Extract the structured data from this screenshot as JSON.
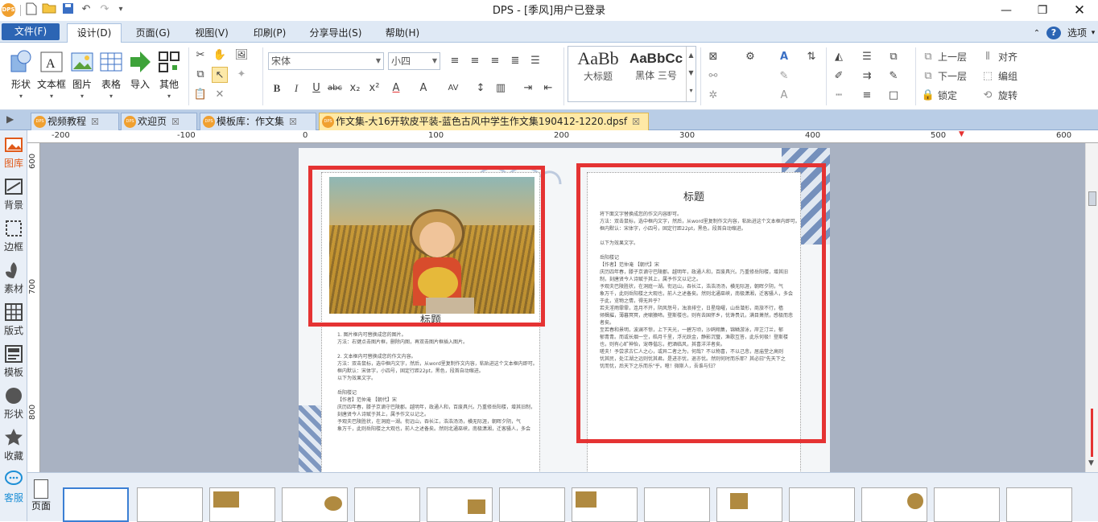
{
  "app": {
    "title": "DPS - [季风]用户已登录",
    "logo": "DPS"
  },
  "menu": {
    "file": "文件(F)",
    "tabs": [
      "设计(D)",
      "页面(G)",
      "视图(V)",
      "印刷(P)",
      "分享导出(S)",
      "帮助(H)"
    ],
    "options": "选项"
  },
  "ribbon": {
    "buttons": [
      "形状",
      "文本框",
      "图片",
      "表格",
      "导入",
      "其他"
    ],
    "font_name": "宋体",
    "font_size": "小四",
    "styles": [
      {
        "sample": "AaBb",
        "label": "大标题"
      },
      {
        "sample": "AaBbCc",
        "label": "黑体 三号"
      }
    ],
    "arrange": [
      "上一层",
      "下一层",
      "锁定",
      "对齐",
      "编组",
      "旋转"
    ]
  },
  "doc_tabs": [
    {
      "label": "视频教程"
    },
    {
      "label": "欢迎页"
    },
    {
      "label": "模板库：作文集"
    },
    {
      "label": "作文集-大16开软皮平装-蓝色古风中学生作文集190412-1220.dpsf",
      "active": true
    }
  ],
  "left_tools": [
    "图库",
    "背景",
    "边框",
    "素材",
    "版式",
    "模板",
    "形状",
    "收藏",
    "客服"
  ],
  "bottom": {
    "page_label": "页面"
  },
  "ruler": {
    "h": [
      "-200",
      "-100",
      "0",
      "100",
      "200",
      "300",
      "400",
      "500",
      "600"
    ],
    "v": [
      "600",
      "700",
      "800"
    ]
  },
  "left_page": {
    "title": "标题",
    "paragraphs": [
      "1. 图片框内可替换成您的图片。",
      "方法：右键点击图片框，删除内图，再双击图片框插入图片。",
      "",
      "2. 文本框内可替换成您的作文内容。",
      "方法：双击鼠标，选中框内文字，然后，从word里复制作文内容，粘贴进这个文本框内即可。",
      "框内默认：宋体字，小四号，固定行距22pt，黑色，段首自动缩进。",
      "以下为效果文字。",
      "",
      "岳阳楼记",
      "【作者】范仲淹 【朝代】宋",
      "庆历四年春，滕子京谪守巴陵郡。越明年，政通人和，百废具兴。乃重修岳阳楼，增其旧制，",
      "刻唐贤今人诗赋于其上，属予作文以记之。",
      "予观夫巴陵胜状，在洞庭一湖。衔远山，吞长江，浩浩汤汤，横无际涯，朝晖夕阴，气",
      "象万千，此则岳阳楼之大观也，前人之述备矣。然则北通巫峡，南极潇湘，迁客骚人，多会"
    ]
  },
  "right_page": {
    "title": "标题",
    "paragraphs": [
      "将下面文字替换成您的作文内容即可。",
      "方法：双击鼠标，选中框内文字，然后，从word里复制作文内容，粘贴进这个文本框内即可。",
      "框内默认：宋体字，小四号，固定行距22pt，黑色，段首自动缩进。",
      "",
      "以下为效果文字。",
      "",
      "岳阳楼记",
      "【作者】范仲淹 【朝代】宋",
      "庆历四年春，滕子京谪守巴陵郡。越明年，政通人和，百废具兴。乃重修岳阳楼，增其旧",
      "制，刻唐贤今人诗赋于其上，属予作文以记之。",
      "予观夫巴陵胜状，在洞庭一湖。衔远山，吞长江，浩浩汤汤，横无际涯，朝晖夕阴，气",
      "象万千，此则岳阳楼之大观也，前人之述备矣。然则北通巫峡，南极潇湘，迁客骚人，多会",
      "于此，览物之情，得无异乎？",
      "若夫淫雨霏霏，连月不开，阴风怒号，浊浪排空，日星隐曜，山岳潜形，商旅不行，樯",
      "倾楫摧，薄暮冥冥，虎啸猿啼。登斯楼也，则有去国怀乡，忧谗畏讥，满目萧然，感极而悲",
      "者矣。",
      "至若春和景明，波澜不惊，上下天光，一碧万顷，沙鸥翔集，锦鳞游泳，岸芷汀兰，郁",
      "郁青青。而或长烟一空，皓月千里，浮光跃金，静影沉璧，渔歌互答，此乐何极！登斯楼",
      "也，则有心旷神怡，宠辱偕忘，把酒临风，其喜洋洋者矣。",
      "嗟夫！予尝求古仁人之心，或异二者之为，何哉？不以物喜，不以己悲，居庙堂之高则",
      "忧其民，处江湖之远则忧其君。是进亦忧，退亦忧。然则何时而乐耶？其必曰\"先天下之",
      "忧而忧，后天下之乐而乐\"乎。噫！微斯人，吾谁与归？"
    ]
  },
  "colors": {
    "accent": "#2c65b4",
    "highlight": "#e53333",
    "tab_active": "#ffe9a6"
  }
}
